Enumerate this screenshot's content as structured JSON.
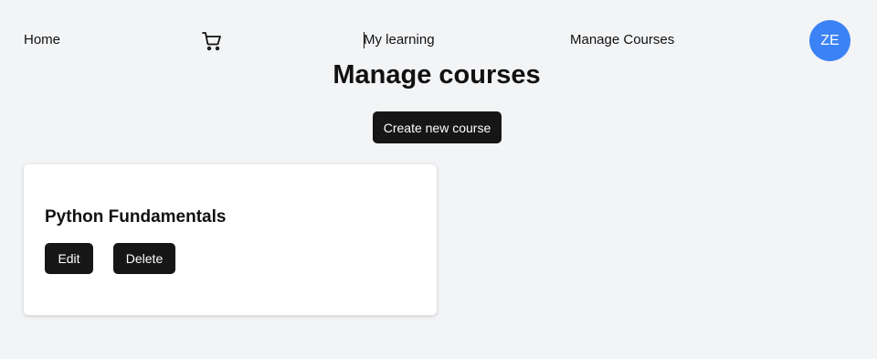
{
  "nav": {
    "home_label": "Home",
    "cart_icon": "shopping-cart-icon",
    "my_learning_label": "My learning",
    "manage_courses_label": "Manage Courses",
    "avatar_initials": "ZE",
    "avatar_color": "#3b82f6"
  },
  "main": {
    "title": "Manage courses",
    "create_button_label": "Create new course",
    "courses": [
      {
        "title": "Python Fundamentals",
        "edit_label": "Edit",
        "delete_label": "Delete"
      }
    ]
  }
}
